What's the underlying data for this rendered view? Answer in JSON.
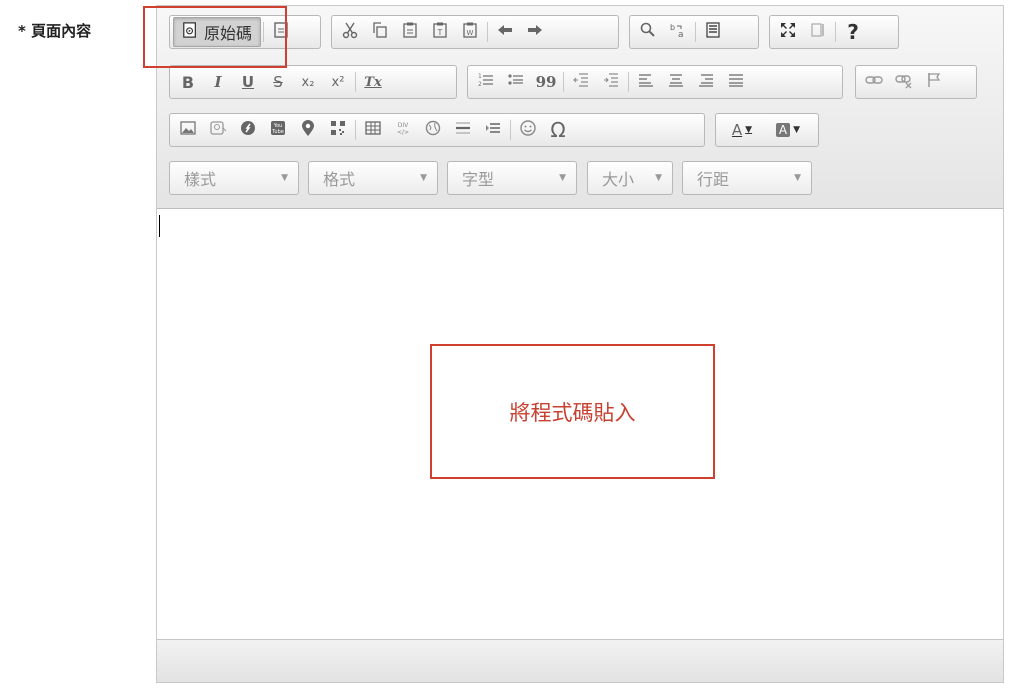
{
  "field": {
    "label": "* 頁面內容"
  },
  "toolbar": {
    "source_label": "原始碼",
    "text_color_label": "A",
    "bg_color_label": "A",
    "help_label": "?",
    "bold": "B",
    "italic": "I",
    "underline": "U",
    "strike": "S",
    "subscript": "x₂",
    "superscript": "x²",
    "remove_format": "Tx",
    "blockquote": "99",
    "omega": "Ω"
  },
  "combos": {
    "styles": "樣式",
    "format": "格式",
    "font": "字型",
    "size": "大小",
    "line_height": "行距"
  },
  "annotation": {
    "paste_hint": "將程式碼貼入"
  },
  "colors": {
    "highlight": "#d04030",
    "toolbar_bg": "#eeeeee"
  }
}
